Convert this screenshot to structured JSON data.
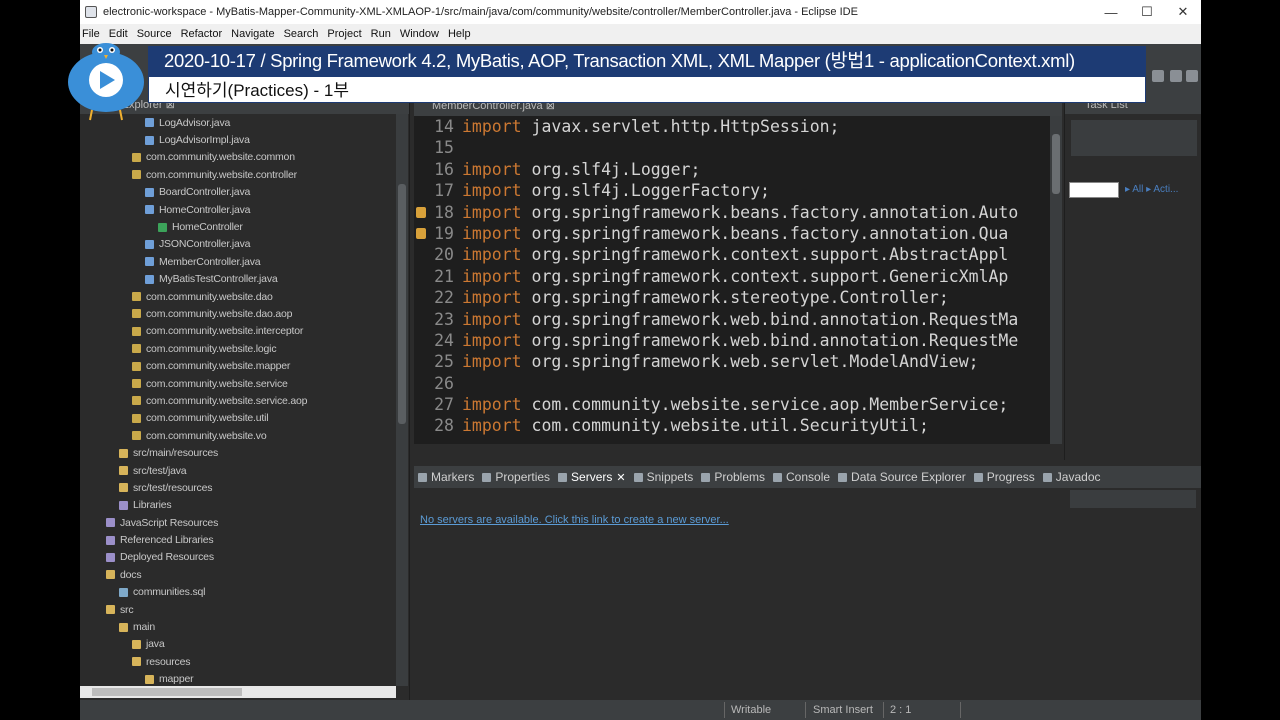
{
  "window": {
    "title": "electronic-workspace - MyBatis-Mapper-Community-XML-XMLAOP-1/src/main/java/com/community/website/controller/MemberController.java - Eclipse IDE",
    "minimize": "—",
    "maximize": "☐",
    "close": "✕"
  },
  "menu": [
    "File",
    "Edit",
    "Source",
    "Refactor",
    "Navigate",
    "Search",
    "Project",
    "Run",
    "Window",
    "Help"
  ],
  "banner": {
    "title": "2020-10-17 / Spring Framework 4.2, MyBatis, AOP, Transaction XML, XML Mapper (방법1 - applicationContext.xml)",
    "subtitle": "시연하기(Practices) - 1부"
  },
  "project_explorer": {
    "tab_label": "ct Explorer ⊠",
    "items": [
      {
        "label": "LogAdvisor.java",
        "indent": 5,
        "icon": "java"
      },
      {
        "label": "LogAdvisorImpl.java",
        "indent": 5,
        "icon": "java"
      },
      {
        "label": "com.community.website.common",
        "indent": 4,
        "icon": "pkg"
      },
      {
        "label": "com.community.website.controller",
        "indent": 4,
        "icon": "pkg"
      },
      {
        "label": "BoardController.java",
        "indent": 5,
        "icon": "java"
      },
      {
        "label": "HomeController.java",
        "indent": 5,
        "icon": "java"
      },
      {
        "label": "HomeController",
        "indent": 6,
        "icon": "class"
      },
      {
        "label": "JSONController.java",
        "indent": 5,
        "icon": "java"
      },
      {
        "label": "MemberController.java",
        "indent": 5,
        "icon": "java"
      },
      {
        "label": "MyBatisTestController.java",
        "indent": 5,
        "icon": "java"
      },
      {
        "label": "com.community.website.dao",
        "indent": 4,
        "icon": "pkg"
      },
      {
        "label": "com.community.website.dao.aop",
        "indent": 4,
        "icon": "pkg"
      },
      {
        "label": "com.community.website.interceptor",
        "indent": 4,
        "icon": "pkg"
      },
      {
        "label": "com.community.website.logic",
        "indent": 4,
        "icon": "pkg"
      },
      {
        "label": "com.community.website.mapper",
        "indent": 4,
        "icon": "pkg"
      },
      {
        "label": "com.community.website.service",
        "indent": 4,
        "icon": "pkg"
      },
      {
        "label": "com.community.website.service.aop",
        "indent": 4,
        "icon": "pkg"
      },
      {
        "label": "com.community.website.util",
        "indent": 4,
        "icon": "pkg"
      },
      {
        "label": "com.community.website.vo",
        "indent": 4,
        "icon": "pkg"
      },
      {
        "label": "src/main/resources",
        "indent": 3,
        "icon": "folder"
      },
      {
        "label": "src/test/java",
        "indent": 3,
        "icon": "folder"
      },
      {
        "label": "src/test/resources",
        "indent": 3,
        "icon": "folder"
      },
      {
        "label": "Libraries",
        "indent": 3,
        "icon": "lib"
      },
      {
        "label": "JavaScript Resources",
        "indent": 2,
        "icon": "lib"
      },
      {
        "label": "Referenced Libraries",
        "indent": 2,
        "icon": "lib"
      },
      {
        "label": "Deployed Resources",
        "indent": 2,
        "icon": "lib"
      },
      {
        "label": "docs",
        "indent": 2,
        "icon": "folder"
      },
      {
        "label": "communities.sql",
        "indent": 3,
        "icon": "file"
      },
      {
        "label": "src",
        "indent": 2,
        "icon": "folder"
      },
      {
        "label": "main",
        "indent": 3,
        "icon": "folder"
      },
      {
        "label": "java",
        "indent": 4,
        "icon": "folder"
      },
      {
        "label": "resources",
        "indent": 4,
        "icon": "folder"
      },
      {
        "label": "mapper",
        "indent": 5,
        "icon": "folder"
      }
    ]
  },
  "editor": {
    "tab_label": "MemberController.java ⊠",
    "lines": [
      {
        "num": "14",
        "kw": "import",
        "text": " javax.servlet.http.HttpSession;",
        "marker": false
      },
      {
        "num": "15",
        "kw": "",
        "text": "",
        "marker": false
      },
      {
        "num": "16",
        "kw": "import",
        "text": " org.slf4j.Logger;",
        "marker": false
      },
      {
        "num": "17",
        "kw": "import",
        "text": " org.slf4j.LoggerFactory;",
        "marker": false
      },
      {
        "num": "18",
        "kw": "import",
        "text": " org.springframework.beans.factory.annotation.Auto",
        "marker": true
      },
      {
        "num": "19",
        "kw": "import",
        "text": " org.springframework.beans.factory.annotation.Qua",
        "marker": true
      },
      {
        "num": "20",
        "kw": "import",
        "text": " org.springframework.context.support.AbstractAppl",
        "marker": false
      },
      {
        "num": "21",
        "kw": "import",
        "text": " org.springframework.context.support.GenericXmlAp",
        "marker": false
      },
      {
        "num": "22",
        "kw": "import",
        "text": " org.springframework.stereotype.Controller;",
        "marker": false
      },
      {
        "num": "23",
        "kw": "import",
        "text": " org.springframework.web.bind.annotation.RequestMa",
        "marker": false
      },
      {
        "num": "24",
        "kw": "import",
        "text": " org.springframework.web.bind.annotation.RequestMe",
        "marker": false
      },
      {
        "num": "25",
        "kw": "import",
        "text": " org.springframework.web.servlet.ModelAndView;",
        "marker": false
      },
      {
        "num": "26",
        "kw": "",
        "text": "",
        "marker": false
      },
      {
        "num": "27",
        "kw": "import",
        "text": " com.community.website.service.aop.MemberService;",
        "marker": false
      },
      {
        "num": "28",
        "kw": "import",
        "text": " com.community.website.util.SecurityUtil;",
        "marker": false
      }
    ]
  },
  "task_list": {
    "tab_label": "Task List",
    "links": "▸ All ▸ Acti..."
  },
  "bottom_tabs": [
    {
      "label": "Markers",
      "active": false
    },
    {
      "label": "Properties",
      "active": false
    },
    {
      "label": "Servers",
      "active": true
    },
    {
      "label": "Snippets",
      "active": false
    },
    {
      "label": "Problems",
      "active": false
    },
    {
      "label": "Console",
      "active": false
    },
    {
      "label": "Data Source Explorer",
      "active": false
    },
    {
      "label": "Progress",
      "active": false
    },
    {
      "label": "Javadoc",
      "active": false
    }
  ],
  "servers": {
    "message": "No servers are available. Click this link to create a new server..."
  },
  "statusbar": {
    "writable": "Writable",
    "insert_mode": "Smart Insert",
    "position": "2 : 1"
  }
}
